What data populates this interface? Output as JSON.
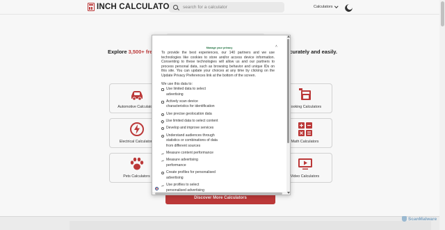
{
  "header": {
    "logo_text": "INCH CALCULATOR",
    "search_placeholder": "search for a calculator",
    "nav_calculators": "Calculators"
  },
  "hero": {
    "tagline_prefix": "Explore ",
    "tagline_count": "3,500+ free",
    "tagline_suffix": "accurately and easily."
  },
  "categories": [
    {
      "label": "Automotive Calculators",
      "icon": "car-icon"
    },
    {
      "label": "Cooking Calculators",
      "icon": "cooking-icon"
    },
    {
      "label": "Electrical Calculators",
      "icon": "lightning-icon"
    },
    {
      "label": "Math Calculators",
      "icon": "math-icon"
    },
    {
      "label": "Pets Calculators",
      "icon": "paw-icon"
    },
    {
      "label": "Video Calculators",
      "icon": "video-icon"
    }
  ],
  "discover_button": "Discover More Calculators",
  "privacy_modal": {
    "title": "Manage your privacy",
    "intro": "To provide the best experiences, our 140 partners and we use technologies like cookies to store and/or access device information. Consenting to these technologies will allow us and our partners to process personal data, such as browsing behavior and unique IDs on this site. You can update your choices at any time by clicking on the Update Privacy Preferences link at the bottom of the screen.",
    "use_heading": "We use this data to:",
    "purposes": [
      "Use limited data to select advertising",
      "Actively scan device characteristics for identification",
      "Use precise geolocation data",
      "Use limited data to select content",
      "Develop and improve services",
      "Understand audiences through statistics or combinations of data from different sources",
      "Measure content performance",
      "Measure advertising performance",
      "Create profiles for personalised advertising",
      "Use profiles to select personalised advertising"
    ]
  },
  "footer": {
    "scanmalware_text": "ScanMalware"
  },
  "colors": {
    "brand_red": "#c23a3a",
    "consent_green": "#1a6e3a"
  }
}
